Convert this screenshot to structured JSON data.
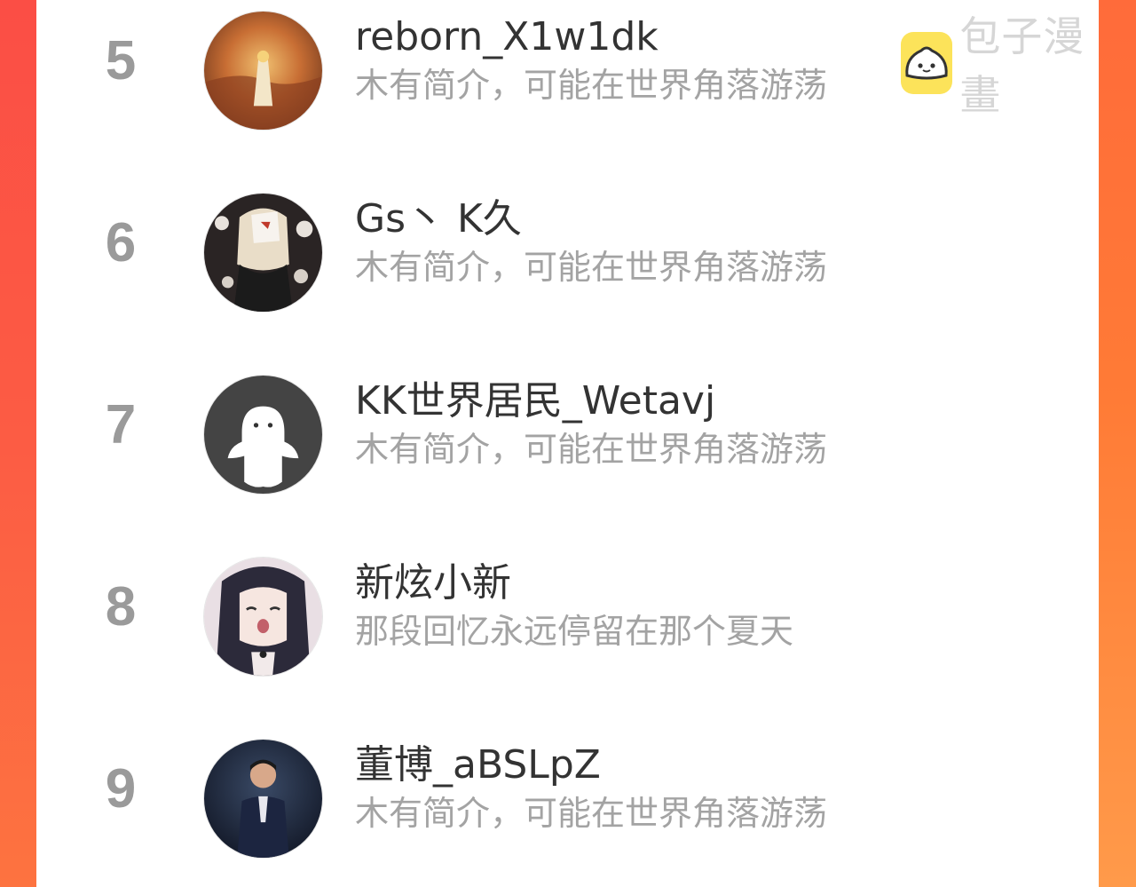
{
  "ranking": [
    {
      "rank": "5",
      "name": "reborn_X1w1dk",
      "bio": "木有简介，可能在世界角落游荡",
      "avatar_icon": "anime-character-sunset-avatar"
    },
    {
      "rank": "6",
      "name": "Gs丶 K久",
      "bio": "木有简介，可能在世界角落游荡",
      "avatar_icon": "masked-anime-girl-avatar"
    },
    {
      "rank": "7",
      "name": "KK世界居民_Wetavj",
      "bio": "木有简介，可能在世界角落游荡",
      "avatar_icon": "default-ghost-avatar"
    },
    {
      "rank": "8",
      "name": "新炫小新",
      "bio": "那段回忆永远停留在那个夏天",
      "avatar_icon": "anime-girl-yawning-avatar"
    },
    {
      "rank": "9",
      "name": "董博_aBSLpZ",
      "bio": "木有简介，可能在世界角落游荡",
      "avatar_icon": "boy-in-suit-avatar"
    }
  ],
  "watermark": {
    "text": "包子漫畫",
    "icon": "bun-face-icon"
  },
  "colors": {
    "rank_gray": "#9a9a9a",
    "name": "#333333",
    "bio": "#a3a3a3",
    "frame_left": "#fb4e45",
    "frame_right": "#ff7b36",
    "watermark_icon_bg": "#fce35a"
  }
}
